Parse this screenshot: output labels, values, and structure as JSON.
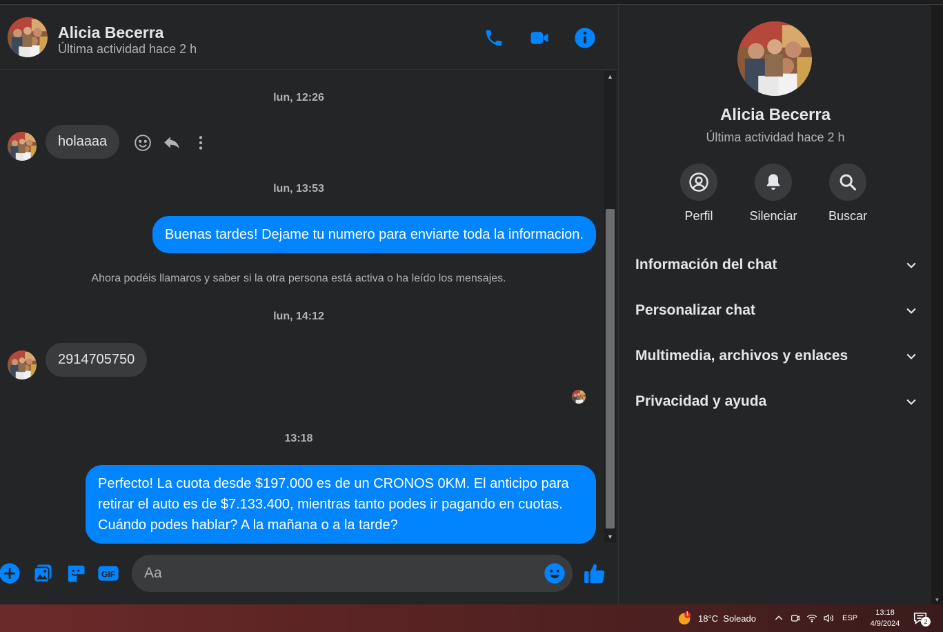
{
  "contact": {
    "name": "Alicia Becerra",
    "status": "Última actividad hace 2 h"
  },
  "header_icons": [
    "phone-icon",
    "video-icon",
    "info-icon"
  ],
  "messages": {
    "ts1": "lun, 12:26",
    "in1": "holaaaa",
    "ts2": "lun, 13:53",
    "out1": "Buenas tardes! Dejame tu numero para enviarte toda la informacion.",
    "notice": "Ahora podéis llamaros y saber si la otra persona está activa o ha leído los mensajes.",
    "ts3": "lun, 14:12",
    "in2": "2914705750",
    "ts4": "13:18",
    "out2": "Perfecto! La cuota desde $197.000 es de un CRONOS 0KM. El anticipo para retirar el auto es de $7.133.400, mientras tanto podes ir pagando en cuotas. Cuándo podes hablar? A la mañana o a la tarde?"
  },
  "composer": {
    "placeholder": "Aa"
  },
  "info_panel": {
    "actions": [
      {
        "label": "Perfil",
        "icon": "profile-icon"
      },
      {
        "label": "Silenciar",
        "icon": "bell-icon"
      },
      {
        "label": "Buscar",
        "icon": "search-icon"
      }
    ],
    "sections": [
      {
        "title": "Información del chat"
      },
      {
        "title": "Personalizar chat"
      },
      {
        "title": "Multimedia, archivos y enlaces"
      },
      {
        "title": "Privacidad y ayuda"
      }
    ]
  },
  "taskbar": {
    "weather": "18°C  Soleado",
    "weather_badge": "1",
    "language": "ESP",
    "time": "13:18",
    "date": "4/9/2024",
    "notif_count": "2"
  },
  "colors": {
    "accent": "#0084ff",
    "background": "#242526",
    "bubble_in": "#3a3b3c"
  }
}
